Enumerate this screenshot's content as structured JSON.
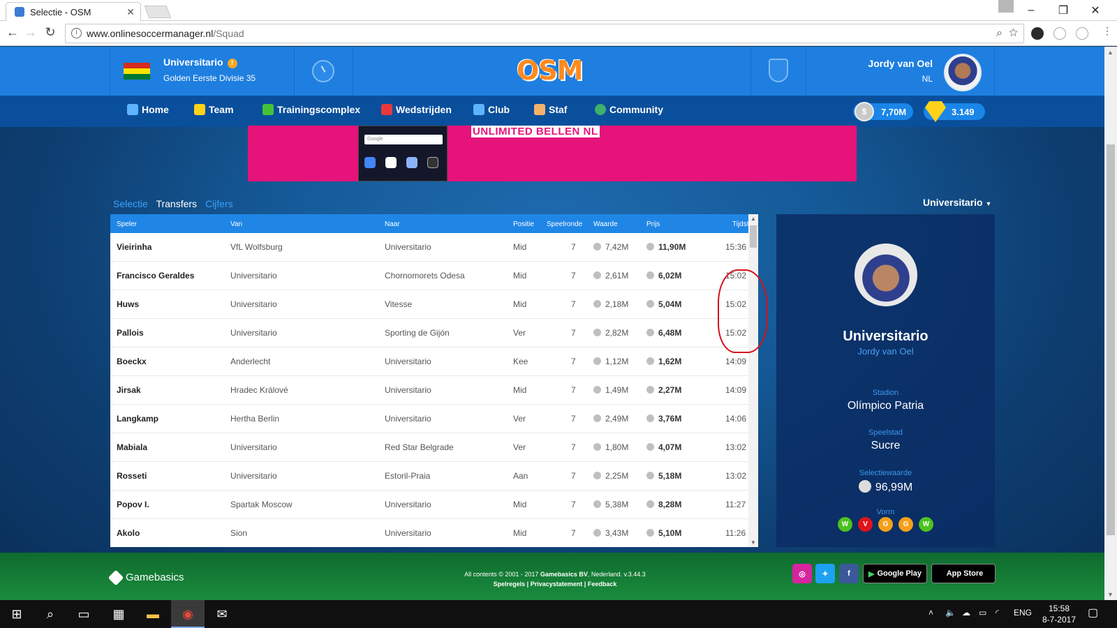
{
  "browser": {
    "tab_title": "Selectie - OSM",
    "url_host": "www.onlinesoccermanager.nl",
    "url_path": "/Squad"
  },
  "header": {
    "club_name": "Universitario",
    "league": "Golden Eerste Divisie 35",
    "logo_text": "OSM",
    "user_name": "Jordy van Oel",
    "user_country": "NL"
  },
  "nav": {
    "items": [
      "Home",
      "Team",
      "Trainingscomplex",
      "Wedstrijden",
      "Club",
      "Staf",
      "Community"
    ],
    "money": "7,70M",
    "coins": "3.149"
  },
  "ad": {
    "headline": "UNLIMITED BELLEN NL",
    "search_placeholder": "Google"
  },
  "subtabs": [
    "Selectie",
    "Transfers",
    "Cijfers"
  ],
  "club_dropdown": "Universitario",
  "table": {
    "headers": [
      "Speler",
      "Van",
      "Naar",
      "Positie",
      "Speelronde",
      "Waarde",
      "Prijs",
      "Tijdstip"
    ],
    "rows": [
      {
        "speler": "Vieirinha",
        "van": "VfL Wolfsburg",
        "naar": "Universitario",
        "positie": "Mid",
        "speelronde": "7",
        "waarde": "7,42M",
        "prijs": "11,90M",
        "tijdstip": "15:36"
      },
      {
        "speler": "Francisco Geraldes",
        "van": "Universitario",
        "naar": "Chornomorets Odesa",
        "positie": "Mid",
        "speelronde": "7",
        "waarde": "2,61M",
        "prijs": "6,02M",
        "tijdstip": "15:02"
      },
      {
        "speler": "Huws",
        "van": "Universitario",
        "naar": "Vitesse",
        "positie": "Mid",
        "speelronde": "7",
        "waarde": "2,18M",
        "prijs": "5,04M",
        "tijdstip": "15:02"
      },
      {
        "speler": "Pallois",
        "van": "Universitario",
        "naar": "Sporting de Gijón",
        "positie": "Ver",
        "speelronde": "7",
        "waarde": "2,82M",
        "prijs": "6,48M",
        "tijdstip": "15:02"
      },
      {
        "speler": "Boeckx",
        "van": "Anderlecht",
        "naar": "Universitario",
        "positie": "Kee",
        "speelronde": "7",
        "waarde": "1,12M",
        "prijs": "1,62M",
        "tijdstip": "14:09"
      },
      {
        "speler": "Jirsak",
        "van": "Hradec Králové",
        "naar": "Universitario",
        "positie": "Mid",
        "speelronde": "7",
        "waarde": "1,49M",
        "prijs": "2,27M",
        "tijdstip": "14:09"
      },
      {
        "speler": "Langkamp",
        "van": "Hertha Berlin",
        "naar": "Universitario",
        "positie": "Ver",
        "speelronde": "7",
        "waarde": "2,49M",
        "prijs": "3,76M",
        "tijdstip": "14:06"
      },
      {
        "speler": "Mabiala",
        "van": "Universitario",
        "naar": "Red Star Belgrade",
        "positie": "Ver",
        "speelronde": "7",
        "waarde": "1,80M",
        "prijs": "4,07M",
        "tijdstip": "13:02"
      },
      {
        "speler": "Rosseti",
        "van": "Universitario",
        "naar": "Estoril-Praia",
        "positie": "Aan",
        "speelronde": "7",
        "waarde": "2,25M",
        "prijs": "5,18M",
        "tijdstip": "13:02"
      },
      {
        "speler": "Popov I.",
        "van": "Spartak Moscow",
        "naar": "Universitario",
        "positie": "Mid",
        "speelronde": "7",
        "waarde": "5,38M",
        "prijs": "8,28M",
        "tijdstip": "11:27"
      },
      {
        "speler": "Akolo",
        "van": "Sion",
        "naar": "Universitario",
        "positie": "Mid",
        "speelronde": "7",
        "waarde": "3,43M",
        "prijs": "5,10M",
        "tijdstip": "11:26"
      }
    ]
  },
  "panel": {
    "club": "Universitario",
    "owner": "Jordy van Oel",
    "stadion_label": "Stadion",
    "stadion": "Olímpico Patria",
    "city_label": "Speelstad",
    "city": "Sucre",
    "value_label": "Selectiewaarde",
    "value": "96,99M",
    "form_label": "Vorm",
    "form": [
      "W",
      "V",
      "G",
      "G",
      "W"
    ],
    "form_colors": {
      "W": "#4cc21e",
      "V": "#e0141c",
      "G": "#f5a01a"
    }
  },
  "footer": {
    "brand": "Gamebasics",
    "copyright_prefix": "All contents © 2001 - 2017 ",
    "copyright_company": "Gamebasics BV",
    "copyright_suffix": ", Nederland. v.3.44.3",
    "links": [
      "Spelregels",
      "Privacystatement",
      "Feedback"
    ],
    "google_play": "Google Play",
    "app_store": "App Store"
  },
  "taskbar": {
    "language": "ENG",
    "time": "15:58",
    "date": "8-7-2017"
  },
  "colors": {
    "accent_blue": "#1e7fe0",
    "nav_blue": "#0a4f9c",
    "annotation_red": "#d4111a"
  }
}
